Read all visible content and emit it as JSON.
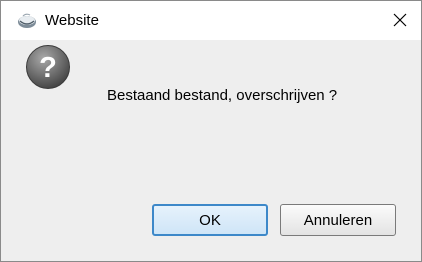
{
  "window": {
    "title": "Website",
    "title_icon": "java-coffee-cup-icon",
    "close_icon": "close-x-icon"
  },
  "dialog": {
    "icon": "question-mark-icon",
    "message": "Bestaand bestand, overschrijven ?"
  },
  "buttons": {
    "ok_label": "OK",
    "cancel_label": "Annuleren"
  },
  "colors": {
    "content_background": "#eeeeee",
    "titlebar_background": "#ffffff",
    "ok_border": "#3d88c9"
  }
}
